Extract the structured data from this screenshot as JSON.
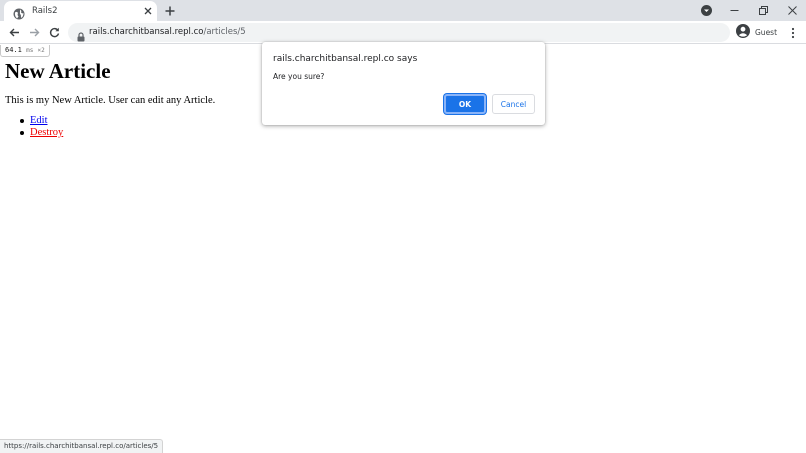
{
  "browser": {
    "tab": {
      "title": "Rails2",
      "favicon": "globe-icon"
    },
    "new_tab_icon": "plus-icon",
    "window_controls": [
      "download-icon",
      "minimize-icon",
      "restore-icon",
      "close-icon"
    ],
    "address": {
      "host": "rails.charchitbansal.repl.co",
      "path": "/articles/5"
    },
    "profile_label": "Guest"
  },
  "page": {
    "perf_badge": {
      "value": "64.1",
      "unit": "ms",
      "extra": "×2"
    },
    "title": "New Article",
    "body": "This is my New Article. User can edit any Article.",
    "actions": [
      {
        "label": "Edit"
      },
      {
        "label": "Destroy"
      }
    ]
  },
  "status_bar": {
    "url": "https://rails.charchitbansal.repl.co/articles/5"
  },
  "dialog": {
    "title": "rails.charchitbansal.repl.co says",
    "message": "Are you sure?",
    "ok_label": "OK",
    "cancel_label": "Cancel"
  },
  "colors": {
    "accent": "#1a73e8",
    "link": "#0000ee",
    "destroy_link": "#ee0000",
    "tabstrip": "#dee1e6"
  }
}
